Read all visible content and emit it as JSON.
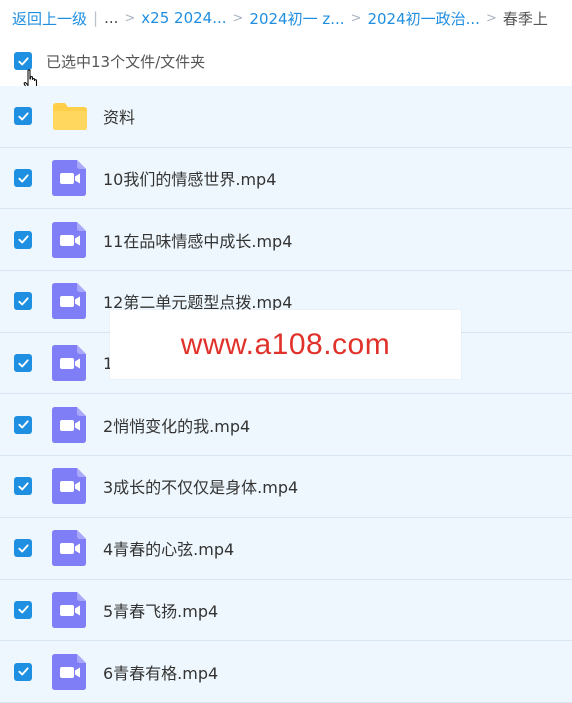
{
  "breadcrumb": {
    "back": "返回上一级",
    "ellipsis": "...",
    "items": [
      "x25 2024...",
      "2024初一 z...",
      "2024初一政治..."
    ],
    "current": "春季上"
  },
  "selection": {
    "text": "已选中13个文件/文件夹"
  },
  "colors": {
    "accent": "#1e8fe1",
    "folder": "#ffcf4a",
    "video": "#7f7ef6",
    "row_bg": "#eef7fd",
    "watermark": "#e0322a"
  },
  "files": [
    {
      "name": "资料",
      "icon": "folder-icon"
    },
    {
      "name": "10我们的情感世界.mp4",
      "icon": "video-icon"
    },
    {
      "name": "11在品味情感中成长.mp4",
      "icon": "video-icon"
    },
    {
      "name": "12第二单元题型点拨.mp4",
      "icon": "video-icon"
    },
    {
      "name": "1",
      "icon": "video-icon"
    },
    {
      "name": "2悄悄变化的我.mp4",
      "icon": "video-icon"
    },
    {
      "name": "3成长的不仅仅是身体.mp4",
      "icon": "video-icon"
    },
    {
      "name": "4青春的心弦.mp4",
      "icon": "video-icon"
    },
    {
      "name": "5青春飞扬.mp4",
      "icon": "video-icon"
    },
    {
      "name": "6青春有格.mp4",
      "icon": "video-icon"
    }
  ],
  "watermark": "www.a108.com"
}
